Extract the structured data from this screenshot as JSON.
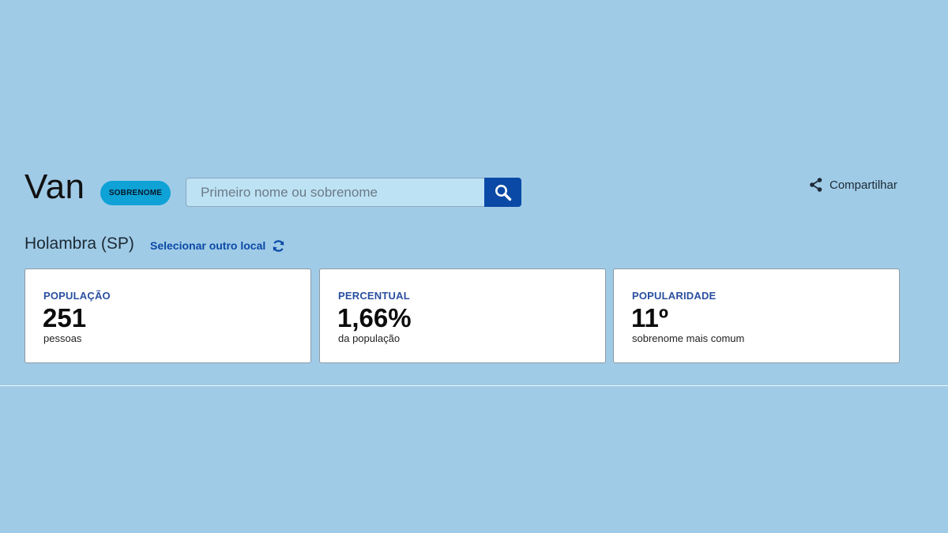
{
  "header": {
    "name": "Van",
    "type_badge": "SOBRENOME",
    "search_placeholder": "Primeiro nome ou sobrenome",
    "share_label": "Compartilhar",
    "search_icon": "search-icon",
    "share_icon": "share-icon"
  },
  "location": {
    "name": "Holambra (SP)",
    "change_label": "Selecionar outro local",
    "change_icon": "refresh-icon"
  },
  "stats": [
    {
      "label": "POPULAÇÃO",
      "value": "251",
      "caption": "pessoas"
    },
    {
      "label": "PERCENTUAL",
      "value": "1,66%",
      "caption": "da população"
    },
    {
      "label": "POPULARIDADE",
      "value": "11º",
      "caption": "sobrenome mais comum"
    }
  ],
  "colors": {
    "background": "#9fcbe6",
    "badge": "#0ea2d6",
    "search_button": "#0a4aa6",
    "link": "#0b4aa6",
    "stat_label": "#2a4fa0"
  }
}
